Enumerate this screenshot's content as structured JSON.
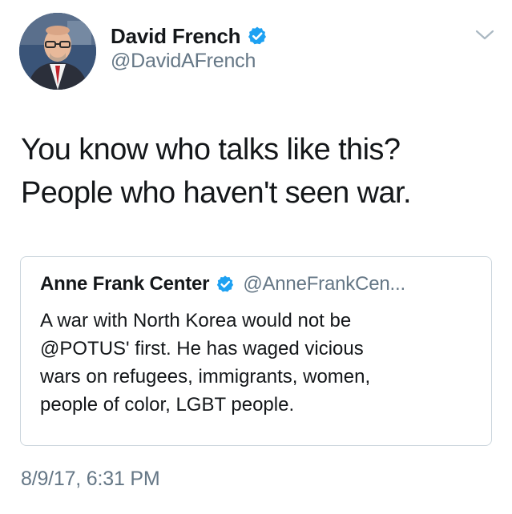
{
  "author": {
    "name": "David French",
    "handle": "@DavidAFrench",
    "verified": true,
    "avatar_icon": "profile-photo"
  },
  "tweet": {
    "text_lines": [
      "You know who talks like this?",
      "People who haven't seen war."
    ]
  },
  "quoted_tweet": {
    "name": "Anne Frank Center",
    "handle": "@AnneFrankCen...",
    "verified": true,
    "text_lines": [
      "A war with North Korea would not be",
      "@POTUS' first. He has waged vicious",
      "wars on refugees, immigrants, women,",
      "people of color, LGBT people."
    ]
  },
  "timestamp": "8/9/17, 6:31 PM",
  "icons": {
    "verified": "verified-badge-icon",
    "menu": "chevron-down-icon"
  },
  "colors": {
    "text": "#14171a",
    "secondary": "#657786",
    "verified": "#1da1f2",
    "border": "#ccd6dd"
  }
}
